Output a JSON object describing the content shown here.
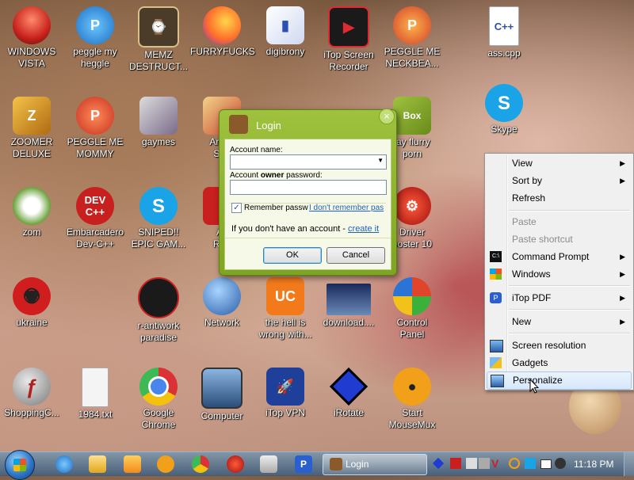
{
  "desktop": {
    "icons": [
      {
        "label1": "WINDOWS",
        "label2": "VISTA",
        "icon": "winvista-icon",
        "color": "#d4322b"
      },
      {
        "label1": "peggle my",
        "label2": "heggle",
        "icon": "peggle-icon",
        "color": "#2b86d4"
      },
      {
        "label1": "MEMZ",
        "label2": "DESTRUCT...",
        "icon": "memz-icon",
        "color": "#6b5a3a"
      },
      {
        "label1": "FURRYFUCKS",
        "label2": "",
        "icon": "firefox-icon",
        "color": "#f37621"
      },
      {
        "label1": "digibrony",
        "label2": "",
        "icon": "folder-icon",
        "color": "#5a78c8"
      },
      {
        "label1": "iTop Screen",
        "label2": "Recorder",
        "icon": "screen-recorder-icon",
        "color": "#e02a32"
      },
      {
        "label1": "PEGGLE ME",
        "label2": "NECKBEA...",
        "icon": "peggle-icon",
        "color": "#d0412b"
      },
      {
        "label1": "ass.cpp",
        "label2": "",
        "icon": "cpp-file-icon",
        "color": "#ffffff"
      },
      {
        "label1": "ZOOMER",
        "label2": "DELUXE",
        "icon": "zuma-icon",
        "color": "#e0a81f"
      },
      {
        "label1": "PEGGLE ME",
        "label2": "MOMMY",
        "icon": "peggle-icon",
        "color": "#d0412b"
      },
      {
        "label1": "gaymes",
        "label2": "",
        "icon": "games-folder-icon",
        "color": "#7a6b8a"
      },
      {
        "label1": "Angry",
        "label2": "Sea",
        "icon": "angry-birds-icon",
        "color": "#c8452f"
      },
      {
        "label1": "jay flurry",
        "label2": "porn",
        "icon": "zoo-box-icon",
        "color": "#8a5a2b"
      },
      {
        "label1": "Skype",
        "label2": "",
        "icon": "skype-icon",
        "color": "#1aa3e6"
      },
      {
        "label1": "zom",
        "label2": "",
        "icon": "plants-vs-zombies-icon",
        "color": "#6aa13a"
      },
      {
        "label1": "Embarcadero",
        "label2": "Dev-C++",
        "icon": "devcpp-icon",
        "color": "#c81f1f"
      },
      {
        "label1": "SNIPED!!",
        "label2": "EPIC GAM...",
        "icon": "skype-icon",
        "color": "#1aa3e6"
      },
      {
        "label1": "Ac",
        "label2": "Rea",
        "icon": "adobe-reader-icon",
        "color": "#c8201f"
      },
      {
        "label1": "Driver",
        "label2": "ooster 10",
        "icon": "driver-booster-icon",
        "color": "#c81f1f"
      },
      {
        "label1": "ukraine",
        "label2": "",
        "icon": "radiation-icon",
        "color": "#c81f1f"
      },
      {
        "label1": "r-antiwork",
        "label2": "paradise",
        "icon": "r-antiwork-icon",
        "color": "#222222"
      },
      {
        "label1": "Network",
        "label2": "",
        "icon": "network-globe-icon",
        "color": "#3b76c4"
      },
      {
        "label1": "the hell is",
        "label2": "wrong with...",
        "icon": "uc-browser-icon",
        "color": "#f27a1b"
      },
      {
        "label1": "download....",
        "label2": "",
        "icon": "video-thumbnail-icon",
        "color": "#3a6aa8"
      },
      {
        "label1": "Control",
        "label2": "Panel",
        "icon": "control-panel-icon",
        "color": "#3c8a3c"
      },
      {
        "label1": "ShoppingC...",
        "label2": "",
        "icon": "flash-icon",
        "color": "#8a8a8a"
      },
      {
        "label1": "1984.txt",
        "label2": "",
        "icon": "text-file-icon",
        "color": "#f4f4f4"
      },
      {
        "label1": "Google",
        "label2": "Chrome",
        "icon": "chrome-icon",
        "color": "#e4a21d"
      },
      {
        "label1": "Computer",
        "label2": "",
        "icon": "computer-icon",
        "color": "#5a7ea8"
      },
      {
        "label1": "iTop VPN",
        "label2": "",
        "icon": "itop-vpn-icon",
        "color": "#1e3f9a"
      },
      {
        "label1": "iRotate",
        "label2": "",
        "icon": "irotate-icon",
        "color": "#1f3bd0"
      },
      {
        "label1": "Start",
        "label2": "MouseMux",
        "icon": "mousemux-icon",
        "color": "#f2a01a"
      }
    ]
  },
  "login_dialog": {
    "title": "Login",
    "close": "×",
    "account_label": "Account name:",
    "password_label_pre": "Account ",
    "password_label_bold": "owner",
    "password_label_post": " password:",
    "remember_label": "Remember passw",
    "forgot_link": "I don't remember pas",
    "no_account_text": "If you don't have an account - ",
    "create_link": "create it",
    "ok_label": "OK",
    "cancel_label": "Cancel",
    "remember_checked": true
  },
  "context_menu": {
    "items": [
      {
        "label": "View",
        "submenu": true,
        "disabled": false,
        "icon": ""
      },
      {
        "label": "Sort by",
        "submenu": true,
        "disabled": false,
        "icon": ""
      },
      {
        "label": "Refresh",
        "submenu": false,
        "disabled": false,
        "icon": ""
      },
      {
        "label": "Paste",
        "submenu": false,
        "disabled": true,
        "icon": ""
      },
      {
        "label": "Paste shortcut",
        "submenu": false,
        "disabled": true,
        "icon": ""
      },
      {
        "label": "Command Prompt",
        "submenu": true,
        "disabled": false,
        "icon": "cmd-icon"
      },
      {
        "label": "Windows",
        "submenu": true,
        "disabled": false,
        "icon": "windows-logo-icon"
      },
      {
        "label": "iTop PDF",
        "submenu": true,
        "disabled": false,
        "icon": "itop-pdf-icon"
      },
      {
        "label": "New",
        "submenu": true,
        "disabled": false,
        "icon": ""
      },
      {
        "label": "Screen resolution",
        "submenu": false,
        "disabled": false,
        "icon": "screen-resolution-icon"
      },
      {
        "label": "Gadgets",
        "submenu": false,
        "disabled": false,
        "icon": "gadgets-icon"
      },
      {
        "label": "Personalize",
        "submenu": false,
        "disabled": false,
        "icon": "personalize-icon",
        "highlighted": true
      }
    ],
    "arrow": "▶"
  },
  "taskbar": {
    "login_task_label": "Login",
    "clock": "11:18 PM",
    "accent": "#2f78c8"
  }
}
